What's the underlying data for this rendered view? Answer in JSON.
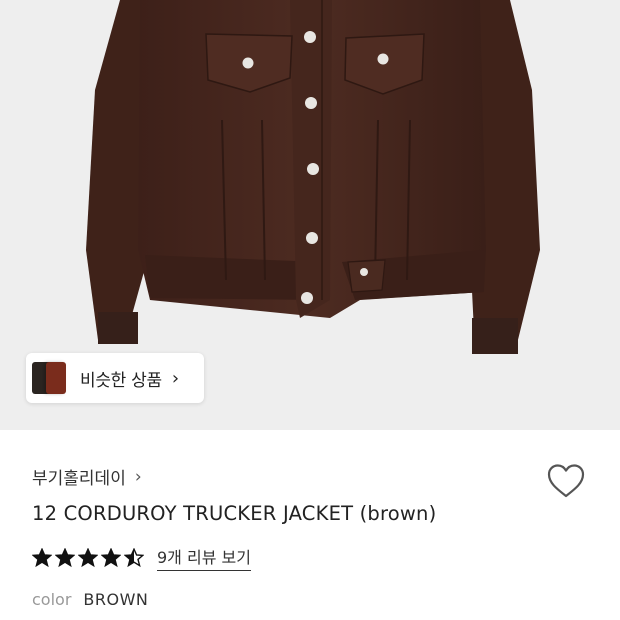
{
  "similar": {
    "label": "비슷한 상품",
    "chevron": "›"
  },
  "product": {
    "brand": "부기홀리데이",
    "brand_chevron": "›",
    "title": "12 CORDUROY TRUCKER JACKET (brown)",
    "rating": 4.5,
    "rating_max": 5,
    "review_link": "9개 리뷰 보기",
    "color_label": "color",
    "color_value": "BROWN"
  },
  "icons": {
    "wishlist": "heart-icon",
    "star_full": "star-full-icon",
    "star_half": "star-half-icon"
  },
  "colors": {
    "hero_bg": "#eeeeee",
    "jacket": "#4a2a20",
    "star": "#111111",
    "muted": "#999999"
  }
}
